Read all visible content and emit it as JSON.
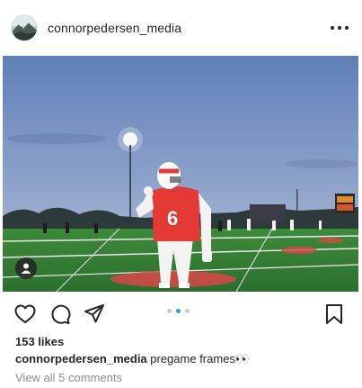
{
  "post": {
    "username": "connorpedersen_media",
    "likes_text": "153 likes",
    "caption_user": "connorpedersen_media",
    "caption_text": " pregame frames👀",
    "view_comments": "View all 5 comments",
    "carousel_total": 3,
    "carousel_active_index": 1
  },
  "photo": {
    "jersey_number": "6"
  },
  "icons": {
    "more": "more-options-icon",
    "user_tag": "user-tag-icon",
    "like": "heart-icon",
    "comment": "comment-icon",
    "share": "paper-plane-icon",
    "save": "bookmark-icon"
  },
  "colors": {
    "text": "#262626",
    "muted": "#8e8e8e",
    "carousel_active": "#3897f0",
    "carousel_inactive": "#c9c9c9"
  }
}
